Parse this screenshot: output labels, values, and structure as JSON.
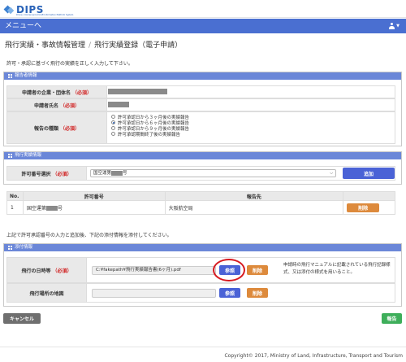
{
  "brand": {
    "name": "DIPS",
    "tagline": "Drone / Unmanned Aircraft Information Platform System"
  },
  "navbar": {
    "menu_label": "メニューへ",
    "user_caret": "▼"
  },
  "breadcrumb": {
    "parent": "飛行実績・事故情報管理",
    "separator": "/",
    "current": "飛行実績登録（電子申請）"
  },
  "intro": "許可・承認に基づく飛行の実績を正しく入力して下さい。",
  "reporter_panel": {
    "title": "報告者情報",
    "company_label": "申請者の企業・団体名",
    "applicant_label": "申請者氏名",
    "type_label": "報告の種類",
    "required": "（必須）",
    "options": [
      {
        "label": "許可承認日から３ヶ月後の実績報告",
        "selected": false
      },
      {
        "label": "許可承認日から６ヶ月後の実績報告",
        "selected": true
      },
      {
        "label": "許可承認日から９ヶ月後の実績報告",
        "selected": false
      },
      {
        "label": "許可承認期間終了後の実績報告",
        "selected": false
      }
    ]
  },
  "flight_panel": {
    "title": "飛行実績情報",
    "permit_label": "許可番号選択",
    "required": "（必須）",
    "permit_selected_prefix": "国空運第",
    "permit_selected_suffix": "号",
    "add_button": "追加",
    "table": {
      "headers": [
        "No.",
        "許可番号",
        "報告先"
      ],
      "rows": [
        {
          "no": "1",
          "permit_prefix": "国空運第",
          "permit_suffix": "号",
          "dest": "大阪航空局",
          "delete": "削除"
        }
      ]
    }
  },
  "notice": "上記で許可承認番号の入力と追加後、下記の添付情報を添付してください。",
  "attach_panel": {
    "title": "添付情報",
    "flight_log_label": "飛行の日時等",
    "required": "（必須）",
    "flight_log_file": "C:¥fakepath¥飛行実績報告書(6ヶ月).pdf",
    "browse_button": "参照",
    "delete_button": "削除",
    "note": "申請時の飛行マニュアルに記載されている飛行記録様式、又は添付の様式を用いること。",
    "map_label": "飛行場所の地図",
    "map_file": "",
    "map_browse_button": "参照",
    "map_delete_button": "削除"
  },
  "actions": {
    "cancel": "キャンセル",
    "submit": "報告"
  },
  "footer": {
    "copyright": "Copyright© 2017, Ministry of Land, Infrastructure, Transport and Tourism"
  },
  "colors": {
    "navbar": "#4a6fd1",
    "panel_header": "#6b87d8",
    "primary": "#4a62d6",
    "danger": "#dd8a3c",
    "success": "#3eae5a",
    "highlight": "#d7191f"
  }
}
